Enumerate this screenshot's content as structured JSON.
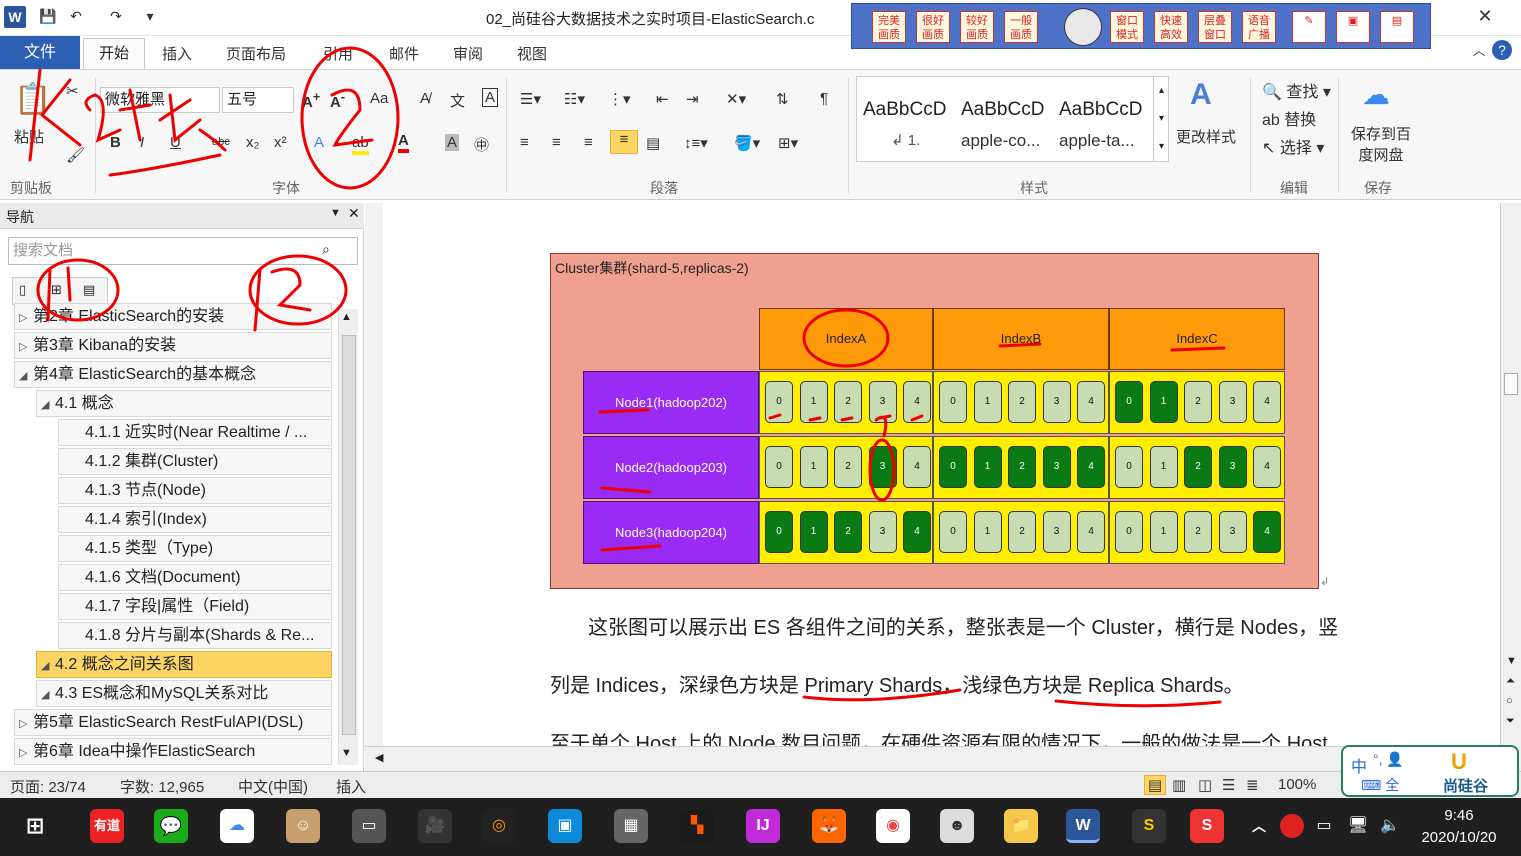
{
  "window": {
    "title": "02_尚硅谷大数据技术之实时项目-ElasticSearch.c",
    "app_icon": "W",
    "controls": {
      "minimize": "—",
      "close": "✕"
    }
  },
  "overlay_toolbar": {
    "buttons": [
      "完美画质",
      "很好画质",
      "较好画质",
      "一般画质",
      "",
      "窗口模式",
      "快速高效",
      "层叠窗口",
      "语音广播"
    ]
  },
  "tabs": [
    "文件",
    "开始",
    "插入",
    "页面布局",
    "引用",
    "邮件",
    "审阅",
    "视图"
  ],
  "ribbon": {
    "clipboard": {
      "paste_label": "粘贴",
      "group_label": "剪贴板"
    },
    "font": {
      "font_name": "微软雅黑",
      "font_size": "五号",
      "group_label": "字体"
    },
    "paragraph": {
      "group_label": "段落"
    },
    "styles": {
      "items": [
        {
          "preview": "AaBbCcD",
          "name": "↲ 1."
        },
        {
          "preview": "AaBbCcD",
          "name": "apple-co..."
        },
        {
          "preview": "AaBbCcD",
          "name": "apple-ta..."
        }
      ],
      "change_label": "更改样式",
      "group_label": "样式"
    },
    "editing": {
      "find": "查找",
      "replace": "替换",
      "select": "选择",
      "group_label": "编辑"
    },
    "save": {
      "label": "保存到百度网盘",
      "group_label": "保存"
    }
  },
  "nav": {
    "header": "导航",
    "search_placeholder": "搜索文档",
    "items": [
      {
        "label": "第2章 ElasticSearch的安装",
        "level": 0,
        "collapsed": true
      },
      {
        "label": "第3章 Kibana的安装",
        "level": 0,
        "collapsed": true
      },
      {
        "label": "第4章 ElasticSearch的基本概念",
        "level": 0,
        "collapsed": false
      },
      {
        "label": "4.1 概念",
        "level": 1,
        "collapsed": false
      },
      {
        "label": "4.1.1 近实时(Near Realtime / ...",
        "level": 2
      },
      {
        "label": "4.1.2 集群(Cluster)",
        "level": 2
      },
      {
        "label": "4.1.3 节点(Node)",
        "level": 2
      },
      {
        "label": "4.1.4 索引(Index)",
        "level": 2
      },
      {
        "label": "4.1.5 类型（Type)",
        "level": 2
      },
      {
        "label": "4.1.6 文档(Document)",
        "level": 2
      },
      {
        "label": "4.1.7 字段|属性（Field)",
        "level": 2
      },
      {
        "label": "4.1.8 分片与副本(Shards & Re...",
        "level": 2
      },
      {
        "label": "4.2 概念之间关系图",
        "level": 1,
        "selected": true
      },
      {
        "label": "4.3 ES概念和MySQL关系对比",
        "level": 1
      },
      {
        "label": "第5章 ElasticSearch RestFulAPI(DSL)",
        "level": 0,
        "collapsed": true
      },
      {
        "label": "第6章 Idea中操作ElasticSearch",
        "level": 0,
        "collapsed": true
      }
    ]
  },
  "diagram": {
    "title": "Cluster集群(shard-5,replicas-2)",
    "indices": [
      "IndexA",
      "IndexB",
      "IndexC"
    ],
    "nodes": [
      "Node1(hadoop202)",
      "Node2(hadoop203)",
      "Node3(hadoop204)"
    ],
    "shard_ids": [
      "0",
      "1",
      "2",
      "3",
      "4"
    ],
    "primary_map": [
      [
        [],
        [],
        [
          0,
          1
        ]
      ],
      [
        [
          3
        ],
        [
          0,
          1,
          2,
          3,
          4
        ],
        [
          2,
          3
        ]
      ],
      [
        [
          0,
          1,
          2,
          4
        ],
        [],
        [
          4
        ]
      ]
    ],
    "colors": {
      "primary": "#0a7a14",
      "replica": "#c7dcb0",
      "node": "#9a2bf4",
      "index": "#ff9a0a",
      "row": "#ffee00",
      "cluster": "#f0a090"
    }
  },
  "document": {
    "para1": "这张图可以展示出 ES 各组件之间的关系，整张表是一个 Cluster，横行是 Nodes，竖",
    "para2_a": "列是 Indices，深绿色方块是 ",
    "para2_b": "Primary Shards",
    "para2_c": "，浅绿色方块是 ",
    "para2_d": "Replica Shards",
    "para2_e": "。",
    "para3": "至于单个 Host 上的 Node 数目问题，在硬件资源有限的情况下，一般的做法是一个 Host"
  },
  "status": {
    "page": "页面: 23/74",
    "words": "字数: 12,965",
    "lang": "中文(中国)",
    "mode": "插入",
    "zoom": "100%"
  },
  "ime": {
    "text": "中",
    "label": "尚硅谷"
  },
  "clock": {
    "time": "9:46",
    "date": "2020/10/20"
  },
  "annotation_text": "Kafka"
}
